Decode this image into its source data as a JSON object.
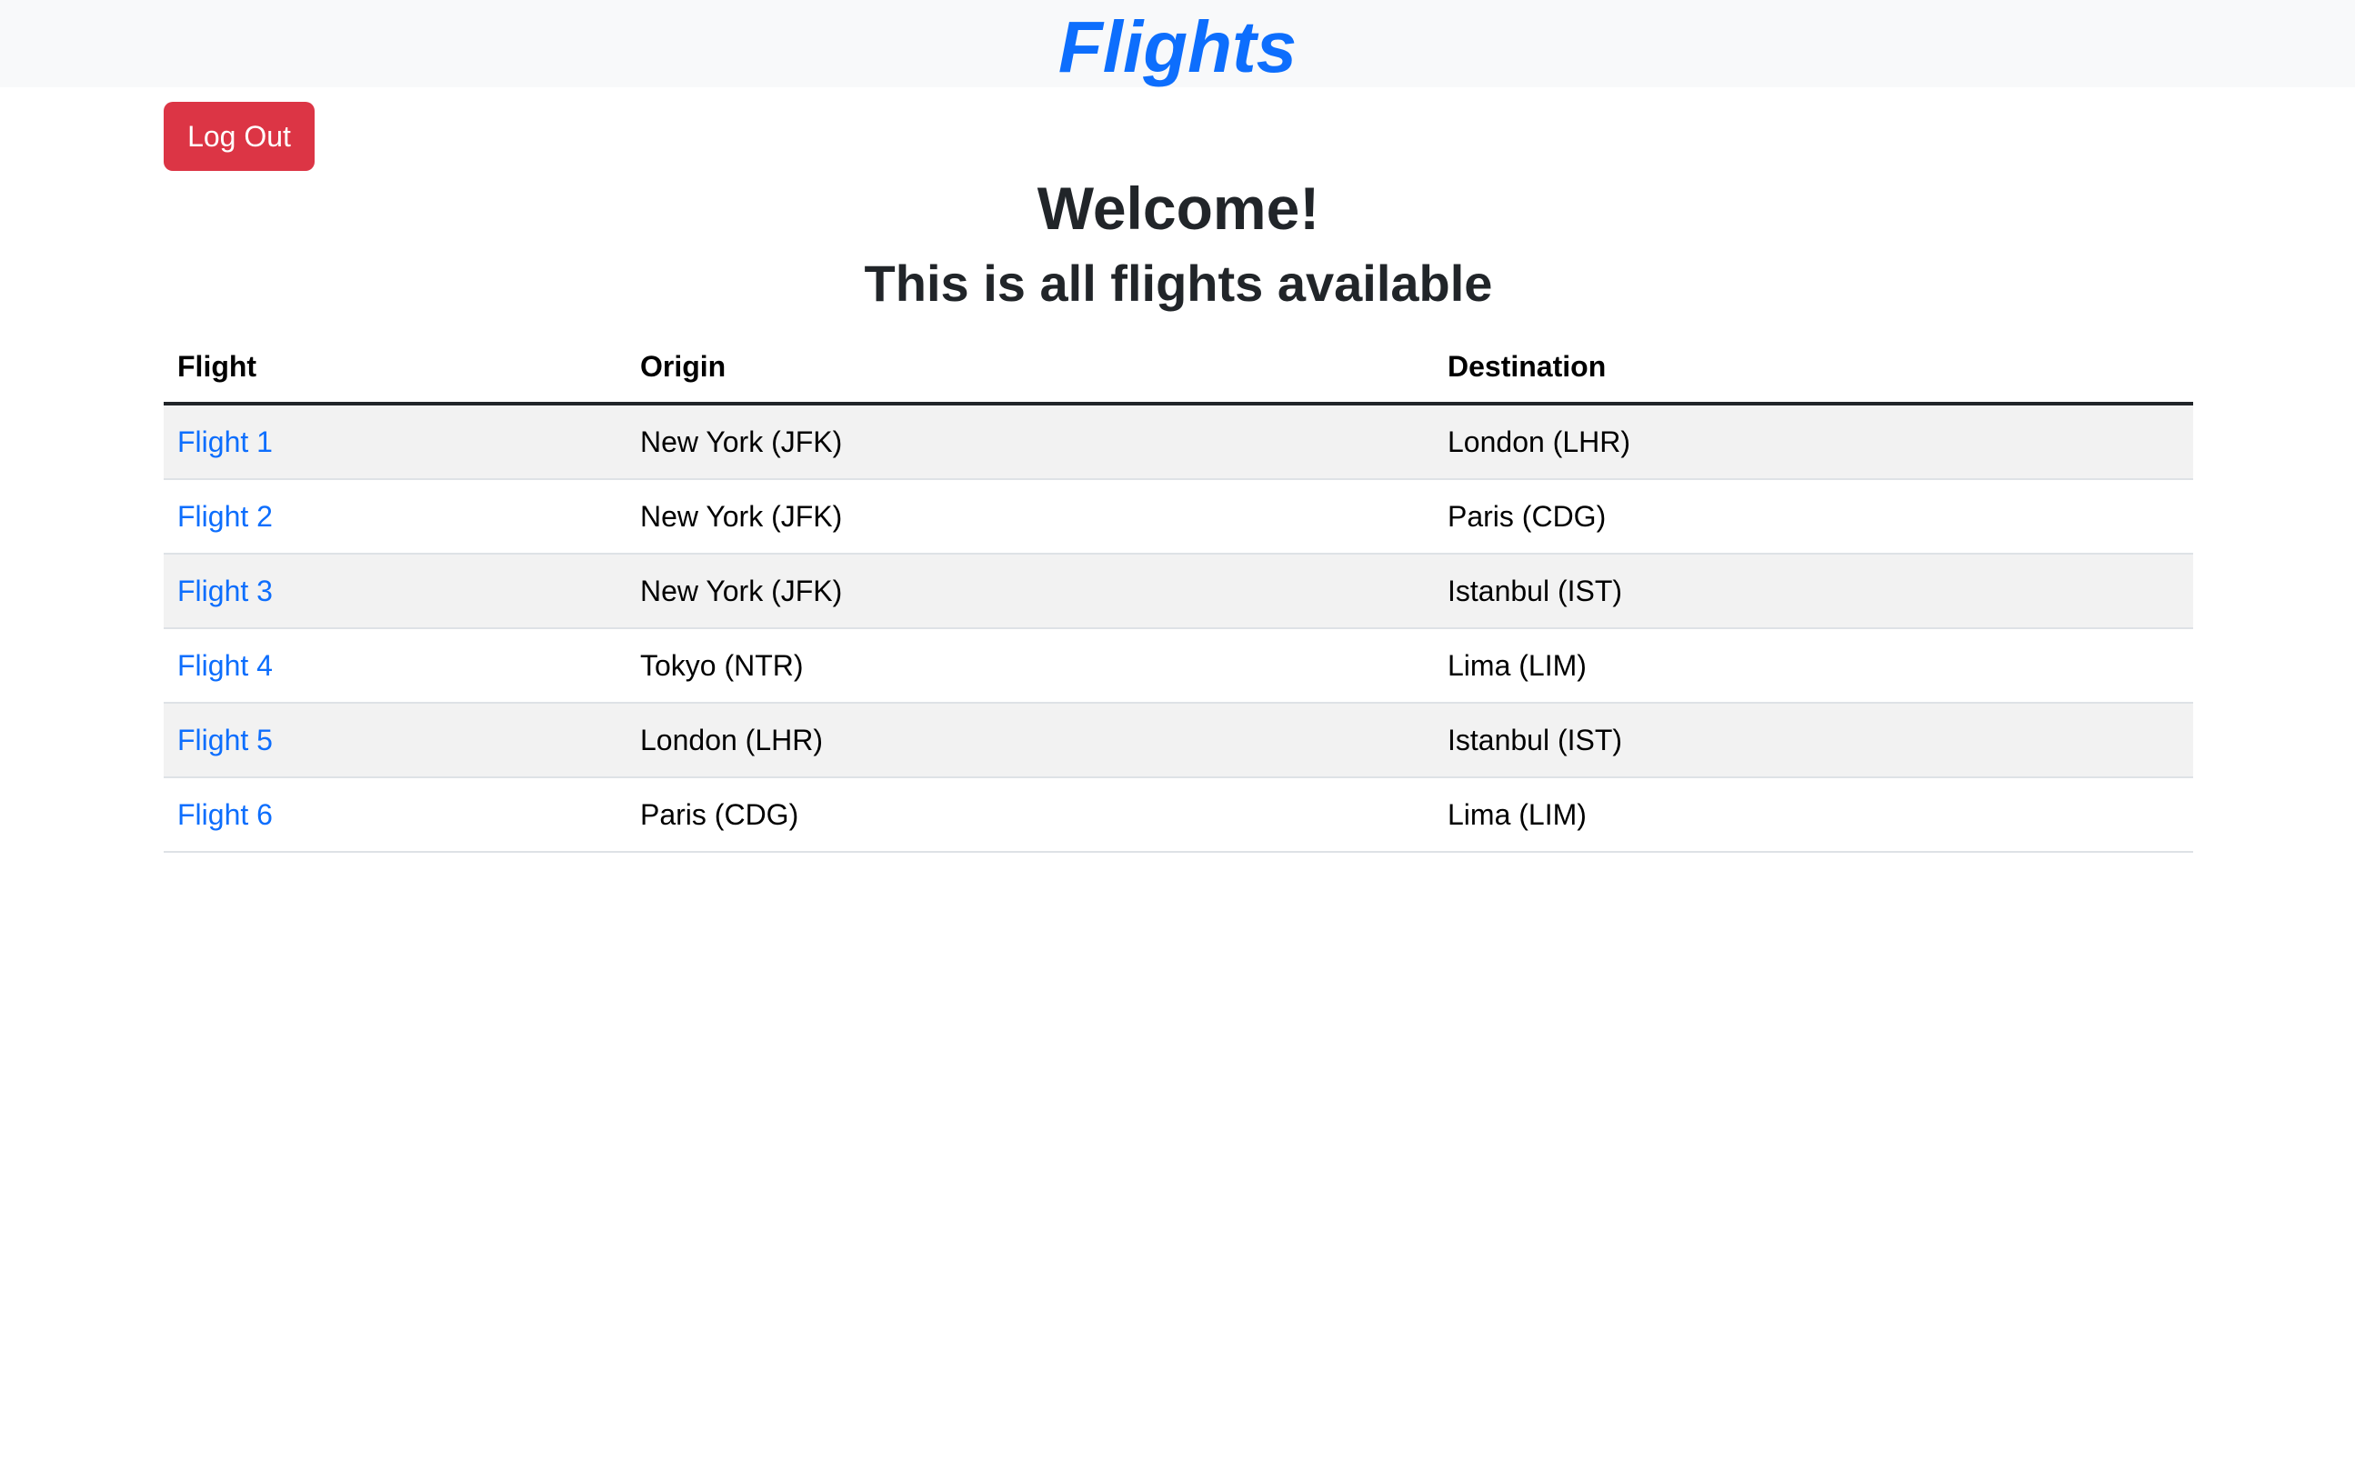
{
  "navbar": {
    "brand": "Flights",
    "brand_color": "#0d6efd",
    "background": "#f8f9fa"
  },
  "logout_button": {
    "label": "Log Out",
    "color": "#dc3545"
  },
  "heading": {
    "welcome": "Welcome!",
    "subtitle": "This is all flights available"
  },
  "table": {
    "headers": {
      "flight": "Flight",
      "origin": "Origin",
      "destination": "Destination"
    },
    "rows": [
      {
        "flight": "Flight 1",
        "origin": "New York (JFK)",
        "destination": "London (LHR)"
      },
      {
        "flight": "Flight 2",
        "origin": "New York (JFK)",
        "destination": "Paris (CDG)"
      },
      {
        "flight": "Flight 3",
        "origin": "New York (JFK)",
        "destination": "Istanbul (IST)"
      },
      {
        "flight": "Flight 4",
        "origin": "Tokyo (NTR)",
        "destination": "Lima (LIM)"
      },
      {
        "flight": "Flight 5",
        "origin": "London (LHR)",
        "destination": "Istanbul (IST)"
      },
      {
        "flight": "Flight 6",
        "origin": "Paris (CDG)",
        "destination": "Lima (LIM)"
      }
    ]
  }
}
